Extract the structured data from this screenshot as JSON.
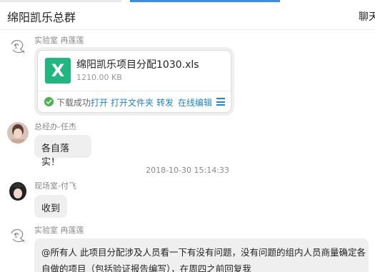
{
  "header": {
    "title": "绵阳凯乐总群",
    "tab_label": "聊天"
  },
  "messages": [
    {
      "sender": "实验室   冉莲莲",
      "avatar_icon": "sketch-avatar-icon",
      "file": {
        "icon_letter": "X",
        "name": "绵阳凯乐项目分配1030.xls",
        "size": "1210.00 KB",
        "status": "下载成功",
        "actions": [
          "打开",
          "打开文件夹",
          "转发",
          "在线编辑"
        ],
        "menu_icon": "hamburger-menu-icon"
      }
    },
    {
      "sender": "总经办-任杰",
      "avatar_icon": "photo-avatar-icon",
      "text": "各自落实！"
    },
    {
      "timestamp": "2018-10-30 15:14:33"
    },
    {
      "sender": "现场室-付飞",
      "avatar_icon": "photo-avatar-icon",
      "text": "收到"
    },
    {
      "sender": "实验室   冉莲莲",
      "avatar_icon": "sketch-avatar-icon",
      "text_lines": [
        "@所有人    此项目分配涉及人员看一下有没有问题，没有问题的组内人员商量确定各",
        "自做的项目（包括验证报告编写），在周四之前回复我"
      ]
    }
  ],
  "colors": {
    "accent": "#1f84d6",
    "excel_green": "#1fb77d",
    "bubble": "#efefef",
    "success": "#47b34a"
  }
}
